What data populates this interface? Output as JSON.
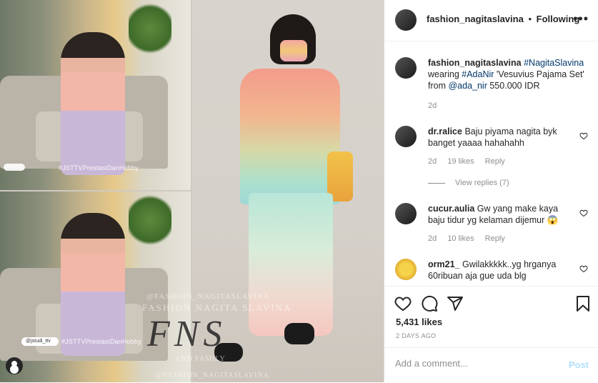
{
  "photo": {
    "top_hashtag": "#JSTTVPrestasiDanHobby",
    "bottom_hashtag": "#JSTTVPrestasiDanHobby",
    "handle_pill": "@jstudi_ttv",
    "watermark_line1": "@FASHION_NAGITASLAVINA",
    "watermark_line2": "FASHION NAGITA SLAVINA",
    "watermark_logo": "FNS",
    "watermark_line4": "AND FAMILY",
    "watermark_line5": "@FASHION_NAGITASLAVINA"
  },
  "header": {
    "username": "fashion_nagitaslavina",
    "separator": "•",
    "follow_label": "Following",
    "more_label": "•••"
  },
  "caption": {
    "username": "fashion_nagitaslavina",
    "hashtag1": "#NagitaSlavina",
    "text1": "wearing",
    "hashtag2": "#AdaNir",
    "text2": "'Vesuvius Pajama Set' from",
    "mention": "@ada_nir",
    "text3": "550.000 IDR",
    "time": "2d"
  },
  "comments": [
    {
      "username": "dr.ralice",
      "text": "Baju piyama nagita byk banget yaaaa hahahahh",
      "time": "2d",
      "likes": "19 likes",
      "reply": "Reply",
      "view_replies": "View replies (7)"
    },
    {
      "username": "cucur.aulia",
      "text": "Gw yang make kaya baju tidur yg kelaman dijemur 😱",
      "time": "2d",
      "likes": "10 likes",
      "reply": "Reply"
    },
    {
      "username": "orm21_",
      "text": "Gwilakkkkk..yg hrganya 60ribuan aja gue uda blg"
    }
  ],
  "actions": {
    "likes": "5,431 likes",
    "date": "2 DAYS AGO"
  },
  "add_comment": {
    "placeholder": "Add a comment...",
    "post_label": "Post"
  },
  "colors": {
    "link": "#00376b",
    "muted": "#8e8e8e",
    "post_disabled": "#b2dffc"
  }
}
